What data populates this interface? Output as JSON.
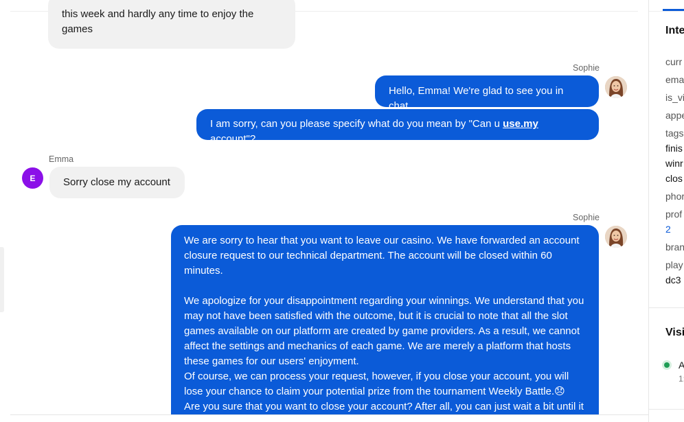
{
  "chat": {
    "messages": [
      {
        "id": "m0",
        "direction": "incoming",
        "sender": "",
        "text": "this week and hardly any time to enjoy the games"
      },
      {
        "id": "m1",
        "direction": "outgoing",
        "sender": "Sophie",
        "text": "Hello, Emma! We're glad to see you in chat."
      },
      {
        "id": "m2",
        "direction": "outgoing",
        "sender": "",
        "text_before": "I am sorry, can you please specify what do you mean by \"Can u ",
        "link": "use.my",
        "text_after": " account\"?"
      },
      {
        "id": "m3",
        "direction": "incoming",
        "sender": "Emma",
        "avatar_initial": "E",
        "text": "Sorry close my account"
      },
      {
        "id": "m4",
        "direction": "outgoing",
        "sender": "Sophie",
        "paragraphs": [
          "We are sorry to hear that you want to leave our casino. We have forwarded an account closure request to our technical department. The account will be closed within 60 minutes.",
          "We apologize for your disappointment regarding your winnings. We understand that you may not have been satisfied with the outcome, but it is crucial to note that all the slot games available on our platform are created by game providers. As a result, we cannot affect the settings and mechanics of each game. We are merely a platform that hosts these games for our users' enjoyment.",
          "Of course, we can process your request, however, if you close your account, you will lose your chance to claim your potential prize from the tournament Weekly Battle.😞",
          "Are you sure that you want to close your account? After all, you can just wait a bit until it"
        ]
      }
    ]
  },
  "sidebar": {
    "section1_title": "Inte",
    "properties": [
      {
        "label": "curr"
      },
      {
        "label": "ema"
      },
      {
        "label": "is_vi"
      },
      {
        "label": "appe"
      },
      {
        "label": "tags",
        "values": [
          "finis",
          "winr",
          "clos"
        ]
      },
      {
        "label": "phor"
      },
      {
        "label": "prof",
        "link": "2"
      },
      {
        "label": "bran"
      },
      {
        "label": "play",
        "value": "dc3"
      }
    ],
    "section2_title": "Visi",
    "visitor": {
      "name": "A",
      "sub": "1:"
    }
  },
  "colors": {
    "accent": "#0b5bd8",
    "incoming_bubble": "#f1f1f1",
    "avatar_e": "#8b10e8",
    "online": "#1f9d55"
  }
}
